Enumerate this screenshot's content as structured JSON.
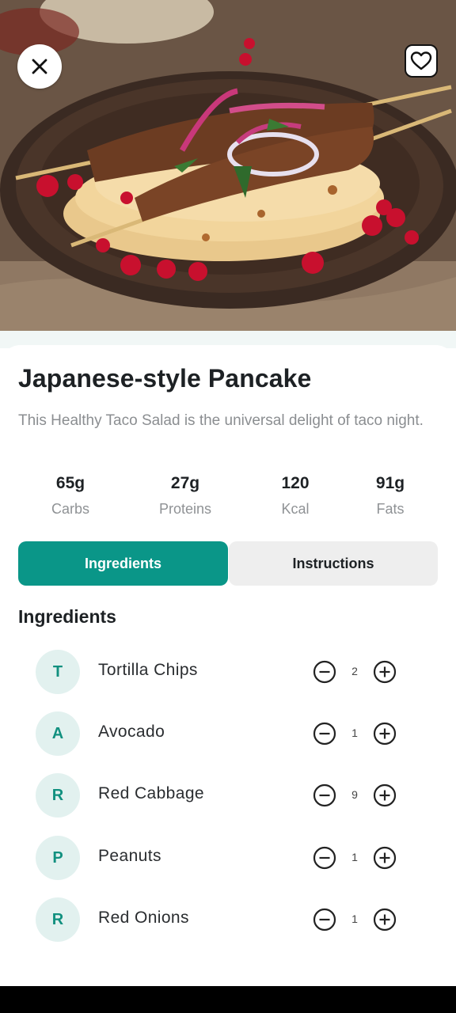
{
  "recipe": {
    "title": "Japanese-style Pancake",
    "description": "This Healthy Taco Salad is the universal delight of taco night."
  },
  "nutrition": [
    {
      "value": "65g",
      "label": "Carbs"
    },
    {
      "value": "27g",
      "label": "Proteins"
    },
    {
      "value": "120",
      "label": "Kcal"
    },
    {
      "value": "91g",
      "label": "Fats"
    }
  ],
  "tabs": {
    "ingredients": "Ingredients",
    "instructions": "Instructions",
    "active": "ingredients"
  },
  "ingredients_section": {
    "title": "Ingredients",
    "items": [
      {
        "initial": "T",
        "name": "Tortilla Chips",
        "qty": "2"
      },
      {
        "initial": "A",
        "name": "Avocado",
        "qty": "1"
      },
      {
        "initial": "R",
        "name": "Red Cabbage",
        "qty": "9"
      },
      {
        "initial": "P",
        "name": "Peanuts",
        "qty": "1"
      },
      {
        "initial": "R",
        "name": "Red Onions",
        "qty": "1"
      }
    ]
  },
  "icons": {
    "close": "close-icon",
    "favorite": "heart-icon",
    "decrement": "minus-circle-icon",
    "increment": "plus-circle-icon"
  },
  "colors": {
    "accent": "#0a9688",
    "avatar_bg": "#e2f1ef",
    "avatar_text": "#11907f",
    "tab_inactive": "#eeeeee"
  }
}
